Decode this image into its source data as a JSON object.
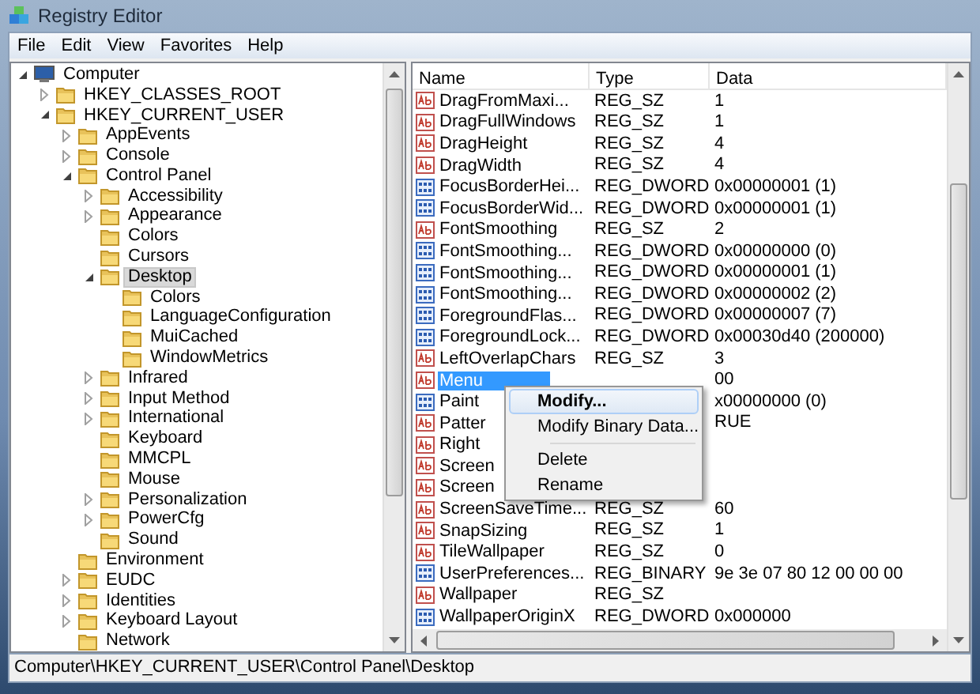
{
  "window": {
    "title": "Registry Editor"
  },
  "menu_bar": [
    "File",
    "Edit",
    "View",
    "Favorites",
    "Help"
  ],
  "tree": [
    {
      "label": "Computer",
      "kind": "computer",
      "expandable": true,
      "expanded": true,
      "selected": false,
      "children": [
        {
          "label": "HKEY_CLASSES_ROOT",
          "kind": "folder",
          "expandable": true,
          "expanded": false,
          "selected": false
        },
        {
          "label": "HKEY_CURRENT_USER",
          "kind": "folder",
          "expandable": true,
          "expanded": true,
          "selected": false,
          "children": [
            {
              "label": "AppEvents",
              "kind": "folder",
              "expandable": true,
              "expanded": false,
              "selected": false
            },
            {
              "label": "Console",
              "kind": "folder",
              "expandable": true,
              "expanded": false,
              "selected": false
            },
            {
              "label": "Control Panel",
              "kind": "folder",
              "expandable": true,
              "expanded": true,
              "selected": false,
              "children": [
                {
                  "label": "Accessibility",
                  "kind": "folder",
                  "expandable": true,
                  "expanded": false,
                  "selected": false
                },
                {
                  "label": "Appearance",
                  "kind": "folder",
                  "expandable": true,
                  "expanded": false,
                  "selected": false
                },
                {
                  "label": "Colors",
                  "kind": "folder",
                  "expandable": false,
                  "selected": false
                },
                {
                  "label": "Cursors",
                  "kind": "folder",
                  "expandable": false,
                  "selected": false
                },
                {
                  "label": "Desktop",
                  "kind": "folder",
                  "expandable": true,
                  "expanded": true,
                  "selected": true,
                  "children": [
                    {
                      "label": "Colors",
                      "kind": "folder",
                      "expandable": false,
                      "selected": false
                    },
                    {
                      "label": "LanguageConfiguration",
                      "kind": "folder",
                      "expandable": false,
                      "selected": false
                    },
                    {
                      "label": "MuiCached",
                      "kind": "folder",
                      "expandable": false,
                      "selected": false
                    },
                    {
                      "label": "WindowMetrics",
                      "kind": "folder",
                      "expandable": false,
                      "selected": false
                    }
                  ]
                },
                {
                  "label": "Infrared",
                  "kind": "folder",
                  "expandable": true,
                  "expanded": false,
                  "selected": false
                },
                {
                  "label": "Input Method",
                  "kind": "folder",
                  "expandable": true,
                  "expanded": false,
                  "selected": false
                },
                {
                  "label": "International",
                  "kind": "folder",
                  "expandable": true,
                  "expanded": false,
                  "selected": false
                },
                {
                  "label": "Keyboard",
                  "kind": "folder",
                  "expandable": false,
                  "selected": false
                },
                {
                  "label": "MMCPL",
                  "kind": "folder",
                  "expandable": false,
                  "selected": false
                },
                {
                  "label": "Mouse",
                  "kind": "folder",
                  "expandable": false,
                  "selected": false
                },
                {
                  "label": "Personalization",
                  "kind": "folder",
                  "expandable": true,
                  "expanded": false,
                  "selected": false
                },
                {
                  "label": "PowerCfg",
                  "kind": "folder",
                  "expandable": true,
                  "expanded": false,
                  "selected": false
                },
                {
                  "label": "Sound",
                  "kind": "folder",
                  "expandable": false,
                  "selected": false
                }
              ]
            },
            {
              "label": "Environment",
              "kind": "folder",
              "expandable": false,
              "selected": false
            },
            {
              "label": "EUDC",
              "kind": "folder",
              "expandable": true,
              "expanded": false,
              "selected": false
            },
            {
              "label": "Identities",
              "kind": "folder",
              "expandable": true,
              "expanded": false,
              "selected": false
            },
            {
              "label": "Keyboard Layout",
              "kind": "folder",
              "expandable": true,
              "expanded": false,
              "selected": false
            },
            {
              "label": "Network",
              "kind": "folder",
              "expandable": false,
              "selected": false
            }
          ]
        }
      ]
    }
  ],
  "values": {
    "columns": [
      "Name",
      "Type",
      "Data"
    ],
    "rows": [
      {
        "kind": "string",
        "name": "DragFromMaxi...",
        "type": "REG_SZ",
        "data": "1",
        "selected": false
      },
      {
        "kind": "string",
        "name": "DragFullWindows",
        "type": "REG_SZ",
        "data": "1",
        "selected": false
      },
      {
        "kind": "string",
        "name": "DragHeight",
        "type": "REG_SZ",
        "data": "4",
        "selected": false
      },
      {
        "kind": "string",
        "name": "DragWidth",
        "type": "REG_SZ",
        "data": "4",
        "selected": false
      },
      {
        "kind": "binary",
        "name": "FocusBorderHei...",
        "type": "REG_DWORD",
        "data": "0x00000001 (1)",
        "selected": false
      },
      {
        "kind": "binary",
        "name": "FocusBorderWid...",
        "type": "REG_DWORD",
        "data": "0x00000001 (1)",
        "selected": false
      },
      {
        "kind": "string",
        "name": "FontSmoothing",
        "type": "REG_SZ",
        "data": "2",
        "selected": false
      },
      {
        "kind": "binary",
        "name": "FontSmoothing...",
        "type": "REG_DWORD",
        "data": "0x00000000 (0)",
        "selected": false
      },
      {
        "kind": "binary",
        "name": "FontSmoothing...",
        "type": "REG_DWORD",
        "data": "0x00000001 (1)",
        "selected": false
      },
      {
        "kind": "binary",
        "name": "FontSmoothing...",
        "type": "REG_DWORD",
        "data": "0x00000002 (2)",
        "selected": false
      },
      {
        "kind": "binary",
        "name": "ForegroundFlas...",
        "type": "REG_DWORD",
        "data": "0x00000007 (7)",
        "selected": false
      },
      {
        "kind": "binary",
        "name": "ForegroundLock...",
        "type": "REG_DWORD",
        "data": "0x00030d40 (200000)",
        "selected": false
      },
      {
        "kind": "string",
        "name": "LeftOverlapChars",
        "type": "REG_SZ",
        "data": "3",
        "selected": false
      },
      {
        "kind": "string",
        "name": "Menu",
        "data": "00",
        "selected": true
      },
      {
        "kind": "binary",
        "name": "Paint",
        "data": "x00000000 (0)",
        "selected": false
      },
      {
        "kind": "string",
        "name": "Patter",
        "data": "RUE",
        "selected": false
      },
      {
        "kind": "string",
        "name": "Right",
        "selected": false
      },
      {
        "kind": "string",
        "name": "Screen",
        "selected": false
      },
      {
        "kind": "string",
        "name": "Screen",
        "selected": false
      },
      {
        "kind": "string",
        "name": "ScreenSaveTime...",
        "type": "REG_SZ",
        "data": "60",
        "selected": false
      },
      {
        "kind": "string",
        "name": "SnapSizing",
        "type": "REG_SZ",
        "data": "1",
        "selected": false
      },
      {
        "kind": "string",
        "name": "TileWallpaper",
        "type": "REG_SZ",
        "data": "0",
        "selected": false
      },
      {
        "kind": "binary",
        "name": "UserPreferences...",
        "type": "REG_BINARY",
        "data": "9e 3e 07 80 12 00 00 00",
        "selected": false
      },
      {
        "kind": "string",
        "name": "Wallpaper",
        "type": "REG_SZ",
        "selected": false
      },
      {
        "kind": "binary",
        "name": "WallpaperOriginX",
        "type": "REG_DWORD",
        "data": "0x000000",
        "selected": false
      }
    ]
  },
  "context_menu": {
    "items": [
      {
        "kind": "item",
        "label": "Modify...",
        "default": true,
        "selected": true
      },
      {
        "kind": "item",
        "label": "Modify Binary Data...",
        "default": false,
        "selected": false
      },
      {
        "kind": "separator"
      },
      {
        "kind": "item",
        "label": "Delete",
        "default": false,
        "selected": false
      },
      {
        "kind": "item",
        "label": "Rename",
        "default": false,
        "selected": false
      }
    ]
  },
  "status_bar": "Computer\\HKEY_CURRENT_USER\\Control Panel\\Desktop"
}
